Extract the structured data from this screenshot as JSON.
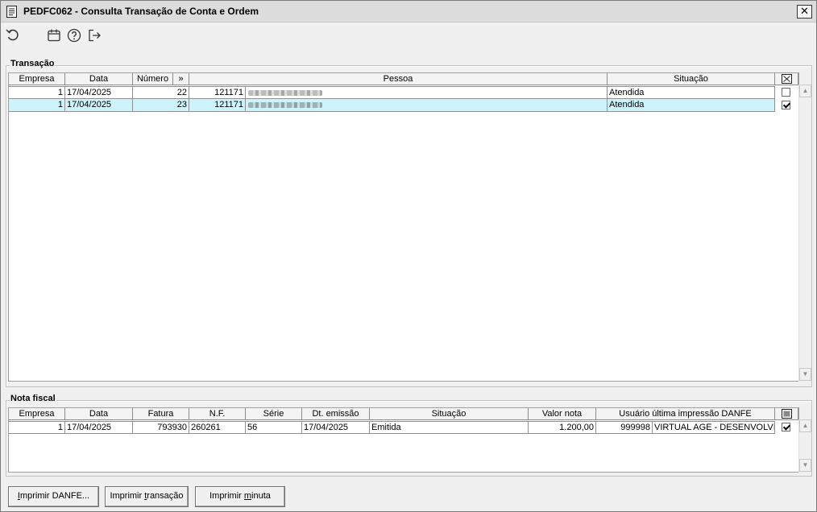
{
  "window": {
    "title": "PEDFC062 - Consulta Transação de Conta e Ordem",
    "close_label": "✕"
  },
  "toolbar": {
    "icons": [
      "refresh-icon",
      "calendar-icon",
      "help-icon",
      "exit-icon"
    ]
  },
  "transacao": {
    "title": "Transação",
    "headers": {
      "empresa": "Empresa",
      "data": "Data",
      "numero": "Número",
      "expand": "»",
      "pessoa": "Pessoa",
      "situacao": "Situação"
    },
    "rows": [
      {
        "empresa": "1",
        "data": "17/04/2025",
        "numero": "22",
        "pessoa_codigo": "121171",
        "situacao": "Atendida",
        "checked": false,
        "selected": false
      },
      {
        "empresa": "1",
        "data": "17/04/2025",
        "numero": "23",
        "pessoa_codigo": "121171",
        "situacao": "Atendida",
        "checked": true,
        "selected": true
      }
    ]
  },
  "nota_fiscal": {
    "title": "Nota fiscal",
    "headers": {
      "empresa": "Empresa",
      "data": "Data",
      "fatura": "Fatura",
      "nf": "N.F.",
      "serie": "Série",
      "dt_emissao": "Dt. emissão",
      "situacao": "Situação",
      "valor_nota": "Valor nota",
      "usuario": "Usuário última impressão DANFE"
    },
    "rows": [
      {
        "empresa": "1",
        "data": "17/04/2025",
        "fatura": "793930",
        "nf": "260261",
        "serie": "56",
        "dt_emissao": "17/04/2025",
        "situacao": "Emitida",
        "valor_nota": "1.200,00",
        "usuario_codigo": "999998",
        "usuario_nome": "VIRTUAL AGE - DESENVOLVIM",
        "checked": true
      }
    ]
  },
  "buttons": {
    "imprimir_danfe": {
      "pre": "",
      "key": "I",
      "post": "mprimir DANFE..."
    },
    "imprimir_transacao": {
      "pre": "Imprimir ",
      "key": "t",
      "post": "ransação"
    },
    "imprimir_minuta": {
      "pre": "Imprimir ",
      "key": "m",
      "post": "inuta"
    }
  }
}
